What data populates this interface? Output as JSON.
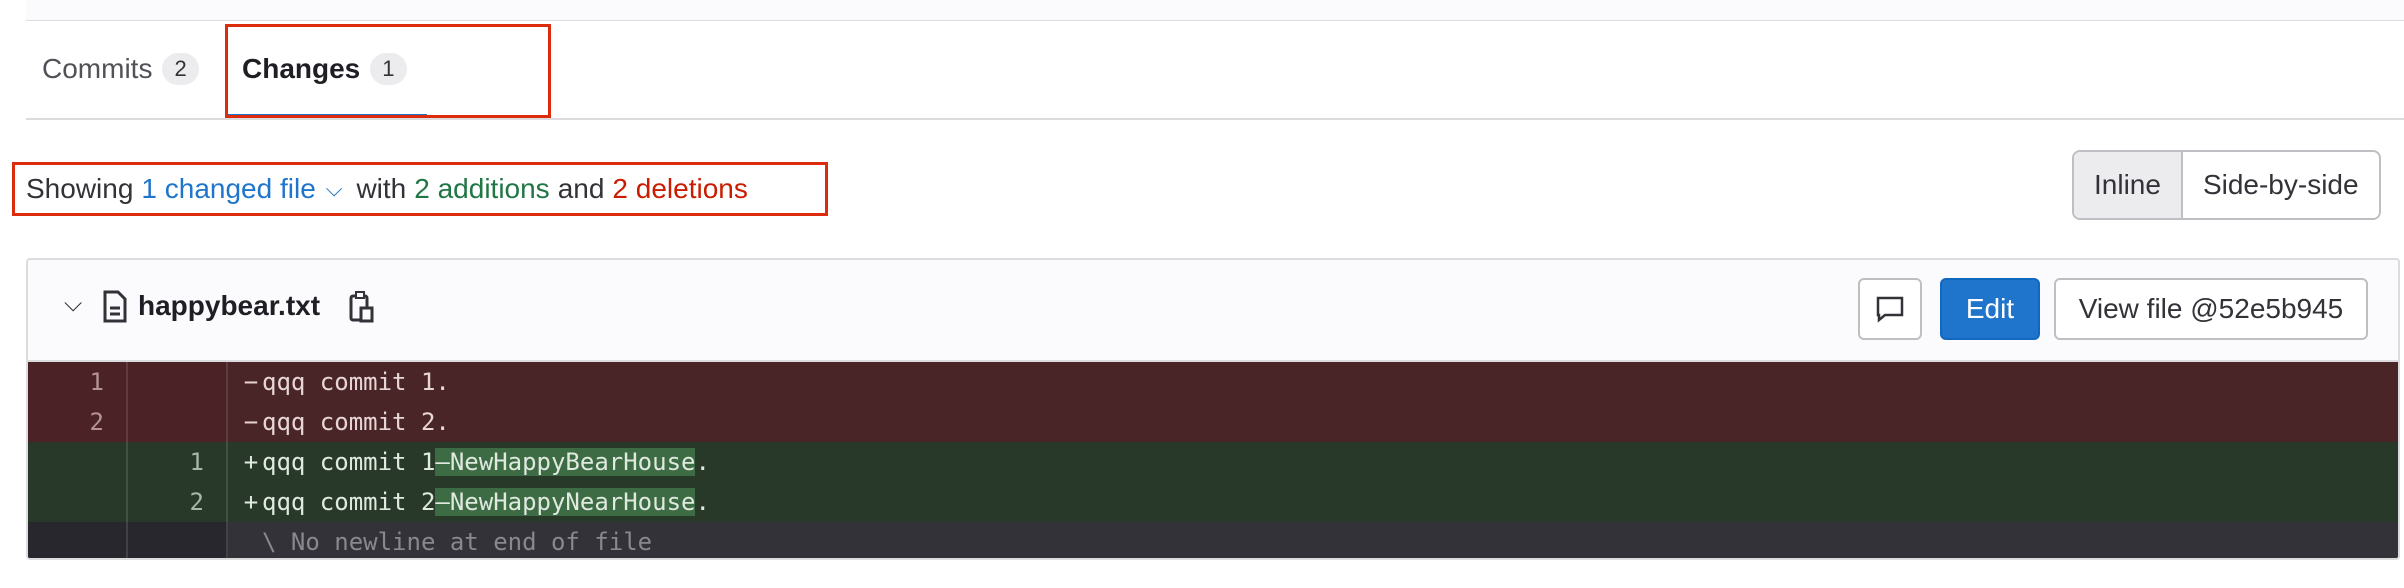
{
  "tabs": [
    {
      "label": "Commits",
      "count": "2"
    },
    {
      "label": "Changes",
      "count": "1"
    }
  ],
  "summary": {
    "prefix": "Showing",
    "files": "1 changed file",
    "with": "with",
    "additions": "2 additions",
    "and": "and",
    "deletions": "2 deletions"
  },
  "view_toggle": {
    "inline": "Inline",
    "side_by_side": "Side-by-side"
  },
  "file": {
    "name": "happybear.txt",
    "edit_label": "Edit",
    "view_label": "View file @52e5b945"
  },
  "diff": {
    "del1": {
      "old": "1",
      "sign": "−",
      "text": "qqq commit 1."
    },
    "del2": {
      "old": "2",
      "sign": "−",
      "text": "qqq commit 2."
    },
    "add1": {
      "new": "1",
      "sign": "+",
      "base": "qqq commit 1",
      "hl": "—NewHappyBearHouse",
      "tail": "."
    },
    "add2": {
      "new": "2",
      "sign": "+",
      "base": "qqq commit 2",
      "hl": "—NewHappyNearHouse",
      "tail": "."
    },
    "meta": "\\ No newline at end of file"
  },
  "colors": {
    "accent": "#1f75cb",
    "additions": "#217645",
    "deletions": "#c91c00",
    "highlight_box": "#dd2b0e"
  }
}
